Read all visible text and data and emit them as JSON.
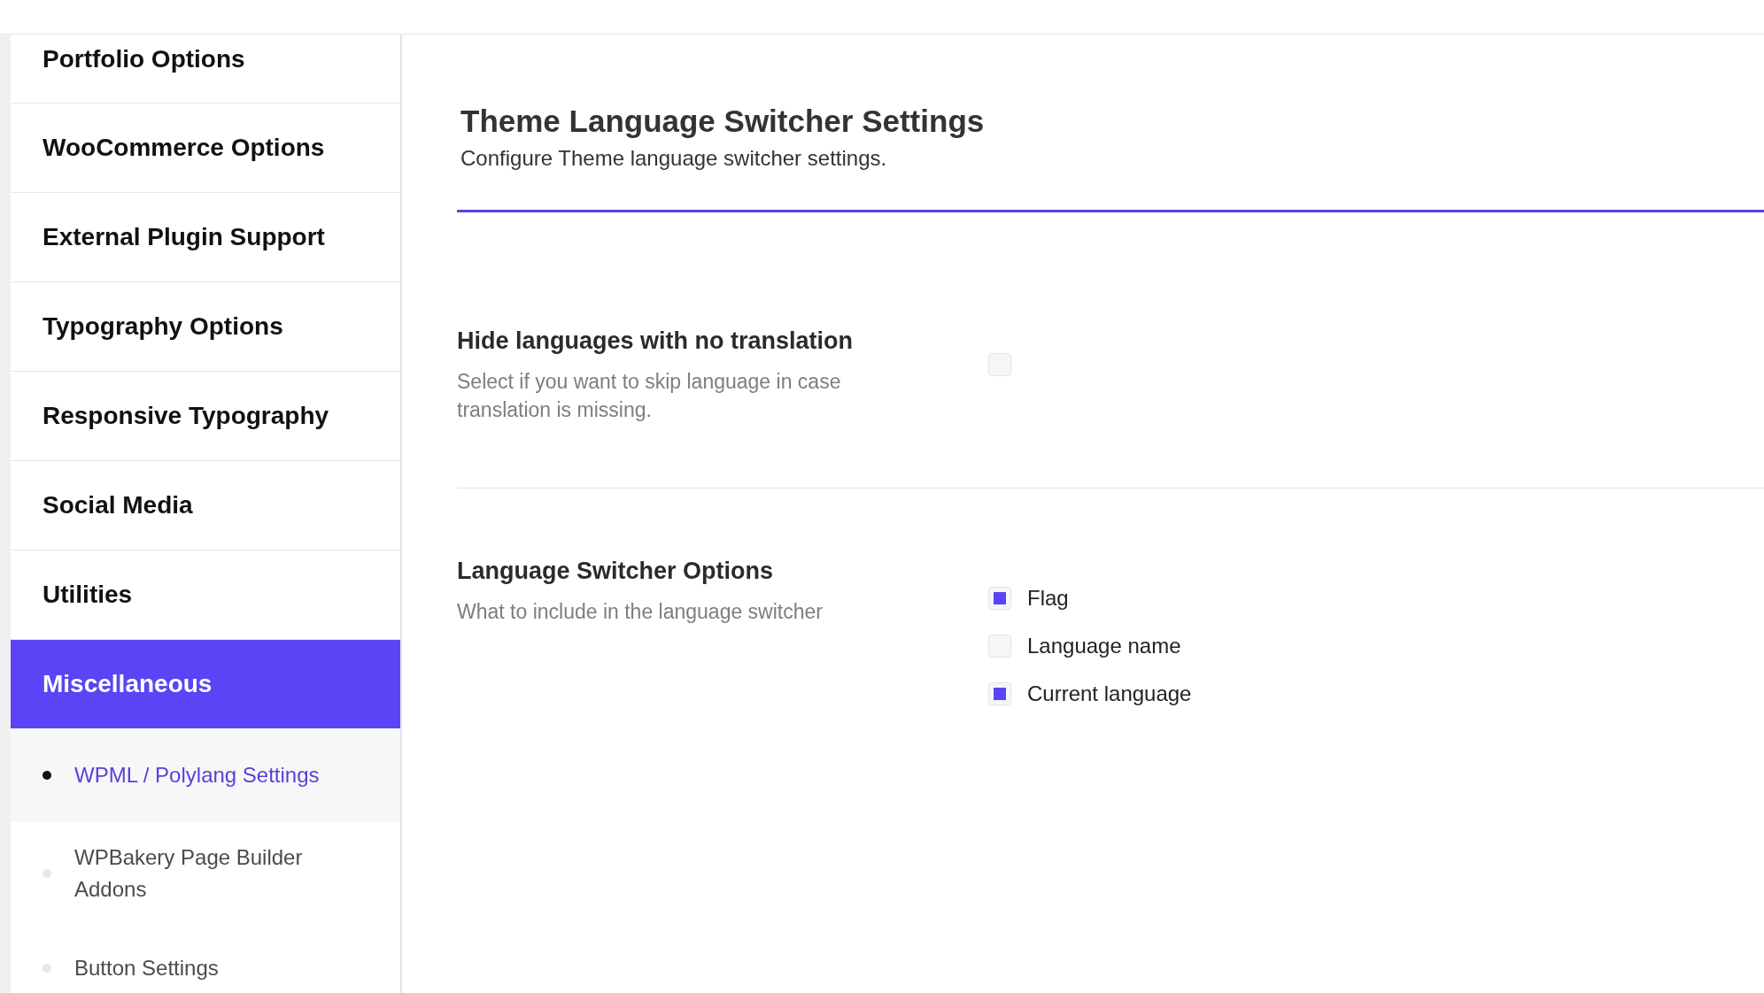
{
  "sidebar": {
    "items": [
      {
        "label": "Portfolio Options",
        "selected": false
      },
      {
        "label": "WooCommerce Options",
        "selected": false
      },
      {
        "label": "External Plugin Support",
        "selected": false
      },
      {
        "label": "Typography Options",
        "selected": false
      },
      {
        "label": "Responsive Typography",
        "selected": false
      },
      {
        "label": "Social Media",
        "selected": false
      },
      {
        "label": "Utilities",
        "selected": false
      },
      {
        "label": "Miscellaneous",
        "selected": true,
        "children": [
          {
            "label": "WPML / Polylang Settings",
            "selected": true
          },
          {
            "label": "WPBakery Page Builder Addons",
            "selected": false
          },
          {
            "label": "Button Settings",
            "selected": false
          }
        ]
      }
    ]
  },
  "page": {
    "title": "Theme Language Switcher Settings",
    "subtitle": "Configure Theme language switcher settings."
  },
  "settings": [
    {
      "heading": "Hide languages with no translation",
      "description": "Select if you want to skip language in case translation is missing.",
      "options": [
        {
          "checked": false
        }
      ]
    },
    {
      "heading": "Language Switcher Options",
      "description": "What to include in the language switcher",
      "options": [
        {
          "label": "Flag",
          "checked": true
        },
        {
          "label": "Language name",
          "checked": false
        },
        {
          "label": "Current language",
          "checked": true
        }
      ]
    }
  ]
}
